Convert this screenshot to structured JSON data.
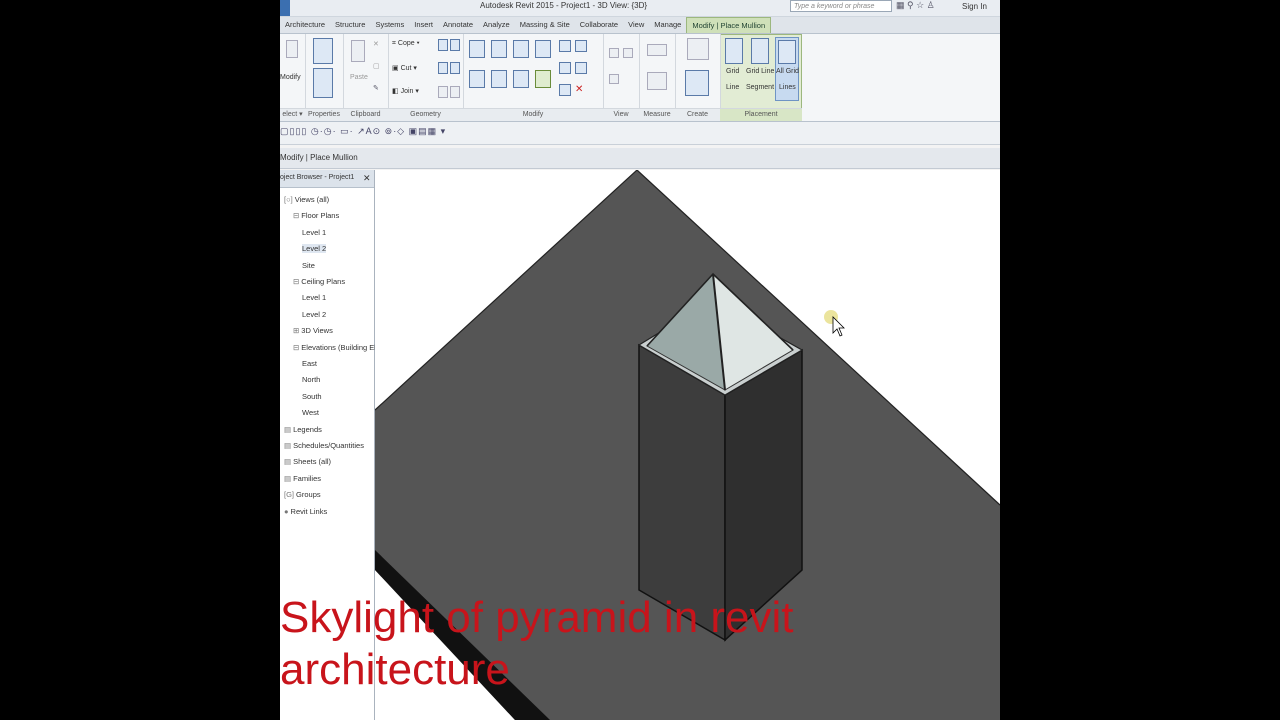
{
  "app": {
    "title": "Autodesk Revit 2015 -     Project1 - 3D View: {3D}",
    "search_placeholder": "Type a keyword or phrase",
    "sign_in": "Sign In"
  },
  "tabs": [
    {
      "label": "Architecture"
    },
    {
      "label": "Structure"
    },
    {
      "label": "Systems"
    },
    {
      "label": "Insert"
    },
    {
      "label": "Annotate"
    },
    {
      "label": "Analyze"
    },
    {
      "label": "Massing & Site"
    },
    {
      "label": "Collaborate"
    },
    {
      "label": "View"
    },
    {
      "label": "Manage"
    },
    {
      "label": "Modify | Place Mullion",
      "active": true
    }
  ],
  "ribbon": {
    "panels": [
      "elect ▾",
      "Properties",
      "Clipboard",
      "Geometry",
      "Modify",
      "View",
      "Measure",
      "Create",
      "Placement"
    ],
    "modify_label": "Modify",
    "paste_label": "Paste",
    "cope_label": "Cope",
    "cut_label": "Cut",
    "join_label": "Join",
    "grid_line": [
      "Grid",
      "Line"
    ],
    "grid_line_segment": [
      "Grid Line",
      "Segment"
    ],
    "all_grid_lines": [
      "All Grid",
      "Lines"
    ]
  },
  "context_bar": {
    "label": "Modify | Place Mullion"
  },
  "project_browser": {
    "title": "oject Browser - Project1",
    "items": [
      {
        "label": "Views (all)",
        "indent": 0,
        "glyph": "[○]"
      },
      {
        "label": "Floor Plans",
        "indent": 1,
        "glyph": "⊟"
      },
      {
        "label": "Level 1",
        "indent": 2,
        "glyph": ""
      },
      {
        "label": "Level 2",
        "indent": 2,
        "glyph": "",
        "selected": true
      },
      {
        "label": "Site",
        "indent": 2,
        "glyph": ""
      },
      {
        "label": "Ceiling Plans",
        "indent": 1,
        "glyph": "⊟"
      },
      {
        "label": "Level 1",
        "indent": 2,
        "glyph": ""
      },
      {
        "label": "Level 2",
        "indent": 2,
        "glyph": ""
      },
      {
        "label": "3D Views",
        "indent": 1,
        "glyph": "⊞"
      },
      {
        "label": "Elevations (Building Elev",
        "indent": 1,
        "glyph": "⊟"
      },
      {
        "label": "East",
        "indent": 2,
        "glyph": ""
      },
      {
        "label": "North",
        "indent": 2,
        "glyph": ""
      },
      {
        "label": "South",
        "indent": 2,
        "glyph": ""
      },
      {
        "label": "West",
        "indent": 2,
        "glyph": ""
      },
      {
        "label": "Legends",
        "indent": 0,
        "glyph": "▤"
      },
      {
        "label": "Schedules/Quantities",
        "indent": 0,
        "glyph": "▤"
      },
      {
        "label": "Sheets (all)",
        "indent": 0,
        "glyph": "▤"
      },
      {
        "label": "Families",
        "indent": 0,
        "glyph": "▤"
      },
      {
        "label": "Groups",
        "indent": 0,
        "glyph": "[G]"
      },
      {
        "label": "Revit Links",
        "indent": 0,
        "glyph": "●"
      }
    ]
  },
  "caption": {
    "line1": "Skylight of pyramid in revit",
    "line2": "architecture"
  },
  "colors": {
    "caption": "#c8141b",
    "roof": "#555555",
    "tower": "#3a3a3a",
    "glass": "#9fb0ae"
  }
}
